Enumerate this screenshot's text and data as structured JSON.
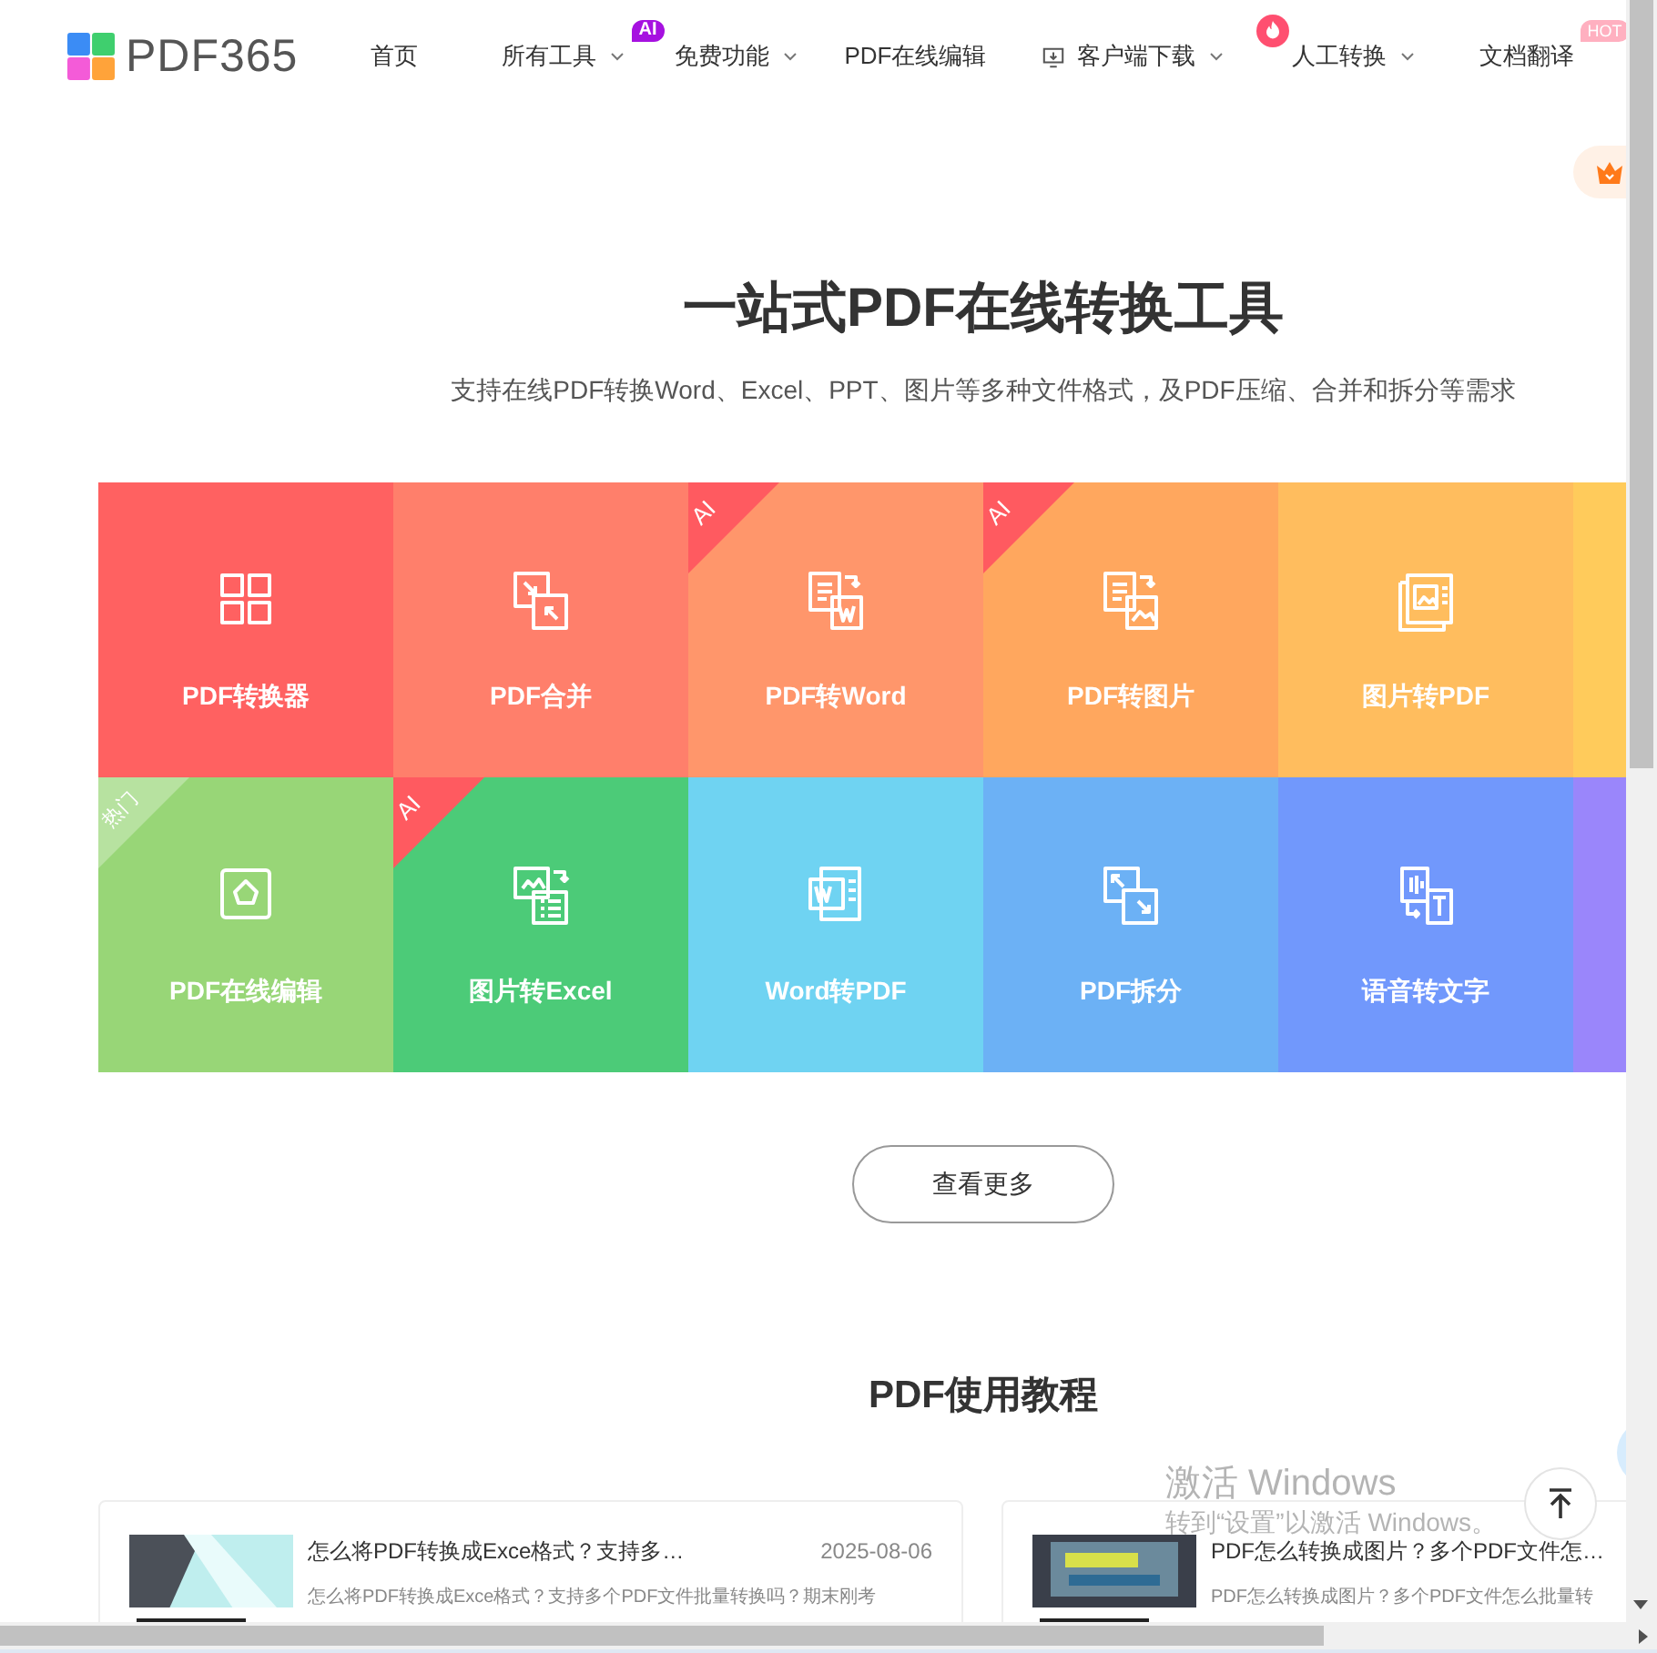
{
  "header": {
    "logo": "PDF365",
    "nav": [
      {
        "label": "首页",
        "caret": false
      },
      {
        "label": "所有工具",
        "caret": true,
        "badge": {
          "kind": "ai",
          "text": "AI"
        }
      },
      {
        "label": "免费功能",
        "caret": true
      },
      {
        "label": "PDF在线编辑",
        "caret": false
      },
      {
        "label": "客户端下载",
        "caret": true,
        "leading_icon": true
      },
      {
        "label": "人工转换",
        "caret": true,
        "badge": {
          "kind": "fire"
        }
      },
      {
        "label": "文档翻译",
        "caret": false,
        "badge": {
          "kind": "hot",
          "text": "HOT"
        }
      }
    ]
  },
  "hero": {
    "title": "一站式PDF在线转换工具",
    "subtitle": "支持在线PDF转换Word、Excel、PPT、图片等多种文件格式，及PDF压缩、合并和拆分等需求"
  },
  "tools": [
    {
      "label": "PDF转换器",
      "color": "#ff6161"
    },
    {
      "label": "PDF合并",
      "color": "#ff7f6b"
    },
    {
      "label": "PDF转Word",
      "color": "#ff966b",
      "badge": {
        "kind": "ai",
        "text": "AI"
      }
    },
    {
      "label": "PDF转图片",
      "color": "#ffa75e",
      "badge": {
        "kind": "ai",
        "text": "AI"
      }
    },
    {
      "label": "图片转PDF",
      "color": "#ffbd5e"
    },
    {
      "color": "#ffcb5b"
    },
    {
      "label": "PDF在线编辑",
      "color": "#98d677",
      "badge": {
        "kind": "hot",
        "text": "热门"
      }
    },
    {
      "label": "图片转Excel",
      "color": "#4ccb78",
      "badge": {
        "kind": "ai",
        "text": "AI"
      }
    },
    {
      "label": "Word转PDF",
      "color": "#6fd3f2"
    },
    {
      "label": "PDF拆分",
      "color": "#6cb1f5"
    },
    {
      "label": "语音转文字",
      "color": "#7198fc"
    },
    {
      "color": "#9a86fb"
    }
  ],
  "more_button": "查看更多",
  "tutorials": {
    "title": "PDF使用教程",
    "articles": [
      {
        "title": "怎么将PDF转换成Exce格式？支持多…",
        "date": "2025-08-06",
        "excerpt": "怎么将PDF转换成Exce格式？支持多个PDF文件批量转换吗？期末刚考"
      },
      {
        "title": "PDF怎么转换成图片？多个PDF文件怎…",
        "excerpt": "PDF怎么转换成图片？多个PDF文件怎么批量转"
      }
    ]
  },
  "os_notice": {
    "title": "激活 Windows",
    "text": "转到“设置”以激活 Windows。"
  }
}
